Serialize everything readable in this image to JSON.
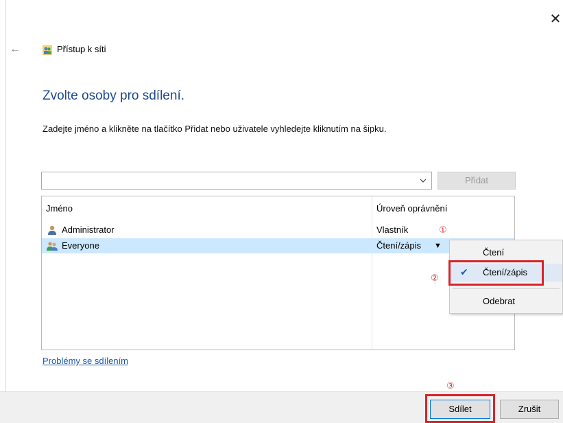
{
  "window": {
    "title": "Přístup k síti",
    "close_glyph": "✕",
    "back_glyph": "←"
  },
  "main": {
    "heading": "Zvolte osoby pro sdílení.",
    "instruction": "Zadejte jméno a klikněte na tlačítko Přidat nebo uživatele vyhledejte kliknutím na šipku.",
    "name_input_value": "",
    "add_button_label": "Přidat",
    "table": {
      "columns": [
        "Jméno",
        "Úroveň oprávnění"
      ],
      "rows": [
        {
          "name": "Administrator",
          "permission": "Vlastník",
          "icon": "user-icon"
        },
        {
          "name": "Everyone",
          "permission": "Čtení/zápis",
          "icon": "users-group-icon",
          "selected": true
        }
      ]
    },
    "help_link": "Problémy se sdílením"
  },
  "permission_menu": {
    "items": [
      "Čtení",
      "Čtení/zápis",
      "Odebrat"
    ],
    "checked_item": "Čtení/zápis"
  },
  "annotations": {
    "step1": "①",
    "step2": "②",
    "step3": "③",
    "highlight_color": "#d8232a"
  },
  "footer": {
    "share_label": "Sdílet",
    "cancel_label": "Zrušit"
  },
  "colors": {
    "heading": "#1e4a8f",
    "selection": "#cce8ff",
    "link": "#1e5aa8"
  }
}
